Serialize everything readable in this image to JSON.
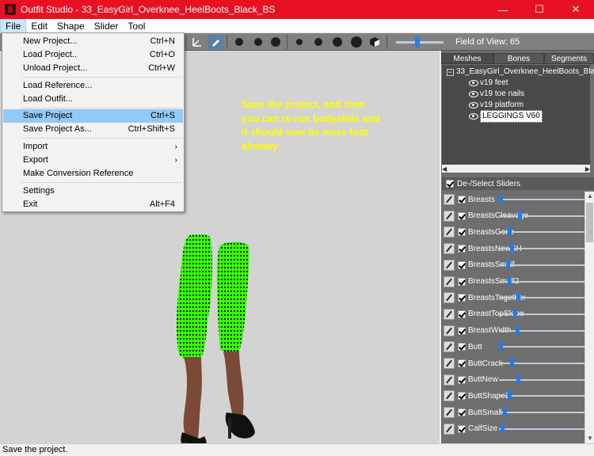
{
  "window": {
    "title": "Outfit Studio - 33_EasyGirl_Overknee_HeelBoots_Black_BS",
    "minimize": "—",
    "maximize": "☐",
    "close": "✕"
  },
  "menubar": [
    "File",
    "Edit",
    "Shape",
    "Slider",
    "Tool"
  ],
  "file_menu": {
    "items": [
      {
        "label": "New Project...",
        "shortcut": "Ctrl+N"
      },
      {
        "label": "Load Project..",
        "shortcut": "Ctrl+O"
      },
      {
        "label": "Unload Project...",
        "shortcut": "Ctrl+W"
      },
      {
        "label": "Load Reference...",
        "shortcut": ""
      },
      {
        "label": "Load Outfit...",
        "shortcut": ""
      },
      {
        "label": "Save Project",
        "shortcut": "Ctrl+S"
      },
      {
        "label": "Save Project As...",
        "shortcut": "Ctrl+Shift+S"
      },
      {
        "label": "Import",
        "shortcut": ""
      },
      {
        "label": "Export",
        "shortcut": ""
      },
      {
        "label": "Make Conversion Reference",
        "shortcut": ""
      },
      {
        "label": "Settings",
        "shortcut": ""
      },
      {
        "label": "Exit",
        "shortcut": "Alt+F4"
      }
    ],
    "highlighted": "Save Project"
  },
  "toolbar": {
    "field_of_view": "Field of View: 65"
  },
  "viewport": {
    "annotation": "Save the project, and then you can re-run bodyslide and it should now be more foot showey"
  },
  "right_panel": {
    "tabs": [
      "Meshes",
      "Bones",
      "Segments"
    ],
    "tree": {
      "root": "33_EasyGirl_Overknee_HeelBoots_Black_B",
      "children": [
        "v19 feet",
        "v19 toe nails",
        "v19 platform",
        "LEGGINGS V60"
      ]
    },
    "sliders_header": "De-/Select Sliders",
    "sliders": [
      {
        "name": "Breasts",
        "value": 0.0
      },
      {
        "name": "BreastsCleavage",
        "value": 0.22
      },
      {
        "name": "BreastsGone",
        "value": 0.1
      },
      {
        "name": "BreastsNewSH",
        "value": 0.13
      },
      {
        "name": "BreastsSmall",
        "value": 0.08
      },
      {
        "name": "BreastsSmall2",
        "value": 0.1
      },
      {
        "name": "BreastsTogether",
        "value": 0.2
      },
      {
        "name": "BreastTopSlope",
        "value": 0.17
      },
      {
        "name": "BreastWidth",
        "value": 0.19
      },
      {
        "name": "Butt",
        "value": 0.0
      },
      {
        "name": "ButtCrack",
        "value": 0.13
      },
      {
        "name": "ButtNew",
        "value": 0.2
      },
      {
        "name": "ButtShape2",
        "value": 0.1
      },
      {
        "name": "ButtSmall",
        "value": 0.05
      },
      {
        "name": "CalfSize",
        "value": 0.02
      }
    ]
  },
  "statusbar": "Save the project."
}
